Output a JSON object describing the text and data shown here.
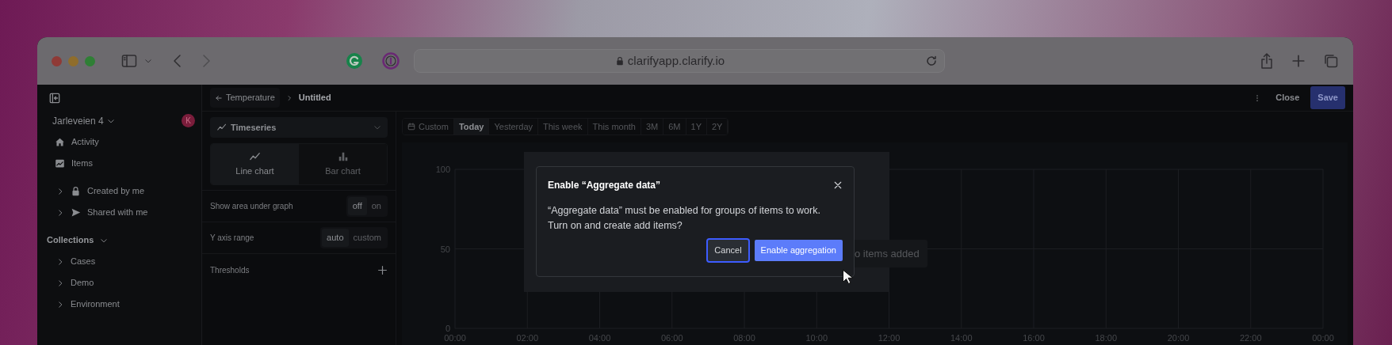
{
  "browser": {
    "url": "clarifyapp.clarify.io"
  },
  "sidebar": {
    "workspace": "Jarleveien 4",
    "avatar": "K",
    "activity": "Activity",
    "items": "Items",
    "groups": [
      {
        "label": "Created by me",
        "kind": "lock",
        "expanded": false
      },
      {
        "label": "Shared with me",
        "kind": "send",
        "expanded": false
      }
    ],
    "collections_heading": "Collections",
    "collections_expanded": true,
    "collections": [
      {
        "label": "Cases",
        "expanded": false
      },
      {
        "label": "Demo",
        "expanded": false
      },
      {
        "label": "Environment",
        "expanded": false
      }
    ]
  },
  "breadcrumb": {
    "back": "Temperature",
    "current": "Untitled"
  },
  "header_actions": {
    "close": "Close",
    "save": "Save"
  },
  "settings": {
    "visualization": "Timeseries",
    "chart_types": [
      {
        "label": "Line chart",
        "kind": "line",
        "selected": true
      },
      {
        "label": "Bar chart",
        "kind": "bar",
        "selected": false
      }
    ],
    "options": [
      {
        "kind": "toggle",
        "label": "Show area under graph",
        "choices": [
          {
            "label": "off",
            "selected": true
          },
          {
            "label": "on",
            "selected": false
          }
        ]
      },
      {
        "kind": "toggle",
        "label": "Y axis range",
        "choices": [
          {
            "label": "auto",
            "selected": true
          },
          {
            "label": "custom",
            "selected": false
          }
        ]
      },
      {
        "kind": "add",
        "label": "Thresholds"
      }
    ]
  },
  "ranges": [
    {
      "label": "Custom",
      "kind": "custom",
      "selected": false
    },
    {
      "label": "Today",
      "kind": "preset",
      "selected": true
    },
    {
      "label": "Yesterday",
      "kind": "preset",
      "selected": false
    },
    {
      "label": "This week",
      "kind": "preset",
      "selected": false
    },
    {
      "label": "This month",
      "kind": "preset",
      "selected": false
    },
    {
      "label": "3M",
      "kind": "preset",
      "selected": false
    },
    {
      "label": "6M",
      "kind": "preset",
      "selected": false
    },
    {
      "label": "1Y",
      "kind": "preset",
      "selected": false
    },
    {
      "label": "2Y",
      "kind": "preset",
      "selected": false
    }
  ],
  "chart": {
    "y_ticks": [
      "100",
      "50",
      "0"
    ],
    "x_ticks": [
      "00:00",
      "02:00",
      "04:00",
      "06:00",
      "08:00",
      "10:00",
      "12:00",
      "14:00",
      "16:00",
      "18:00",
      "20:00",
      "22:00",
      "00:00"
    ],
    "message": "o items added"
  },
  "dialog": {
    "title": "Enable “Aggregate data”",
    "body": "“Aggregate data” must be enabled for groups of items to work.\nTurn on and create add items?",
    "buttons": [
      {
        "label": "Cancel",
        "kind": "secondary",
        "focused": true
      },
      {
        "label": "Enable aggregation",
        "kind": "primary",
        "focused": false
      }
    ]
  }
}
